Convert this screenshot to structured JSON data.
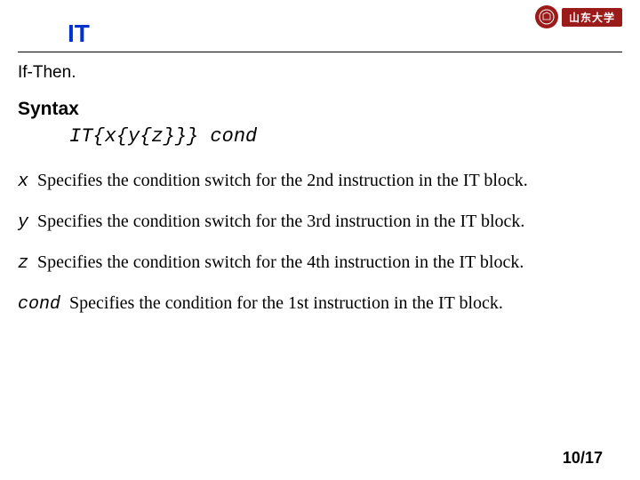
{
  "logo": {
    "text": "山东大学"
  },
  "title": "IT",
  "subtitle": "If-Then.",
  "syntax_head": "Syntax",
  "syntax_code": "IT{x{y{z}}} cond",
  "params": [
    {
      "sym": "x",
      "desc": "Specifies the condition switch for the 2nd instruction in the IT block."
    },
    {
      "sym": "y",
      "desc": "Specifies the condition switch for the 3rd instruction in the IT block."
    },
    {
      "sym": "z",
      "desc": "Specifies the condition switch for the 4th instruction in the IT block."
    },
    {
      "sym": "cond",
      "desc": "Specifies the condition for the 1st instruction in the IT block."
    }
  ],
  "pager": {
    "current": "10",
    "sep": "/",
    "total": "17"
  }
}
